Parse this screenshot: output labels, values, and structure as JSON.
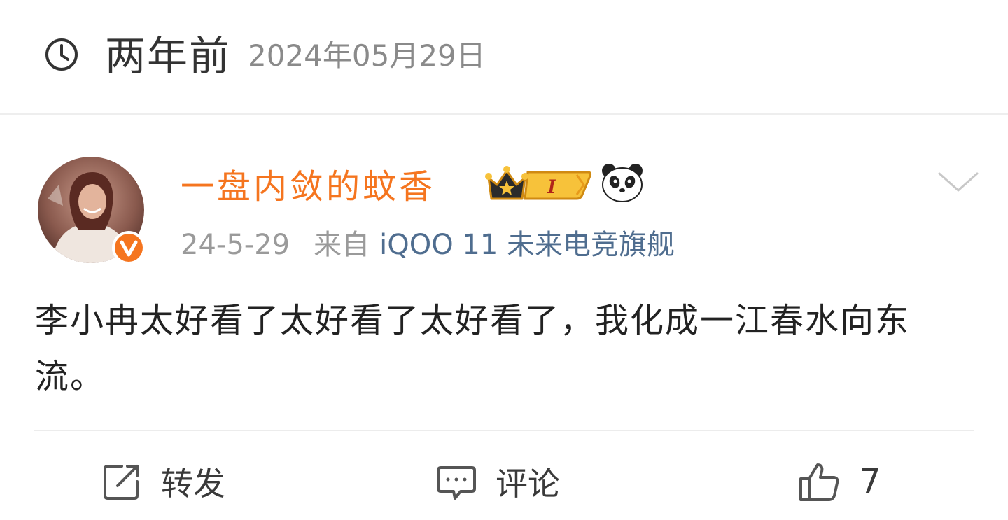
{
  "time_header": {
    "relative": "两年前",
    "date": "2024年05月29日"
  },
  "post": {
    "username": "一盘内敛的蚊香",
    "vip_level": "I",
    "date": "24-5-29",
    "from_label": "来自",
    "source": "iQOO 11 未来电竞旗舰",
    "text": "李小冉太好看了太好看了太好看了，我化成一江春水向东流。"
  },
  "actions": {
    "repost_label": "转发",
    "comment_label": "评论",
    "like_count": "7"
  },
  "colors": {
    "username": "#f5751f",
    "source": "#4f6d8f",
    "verified_badge": "#f5751f"
  }
}
